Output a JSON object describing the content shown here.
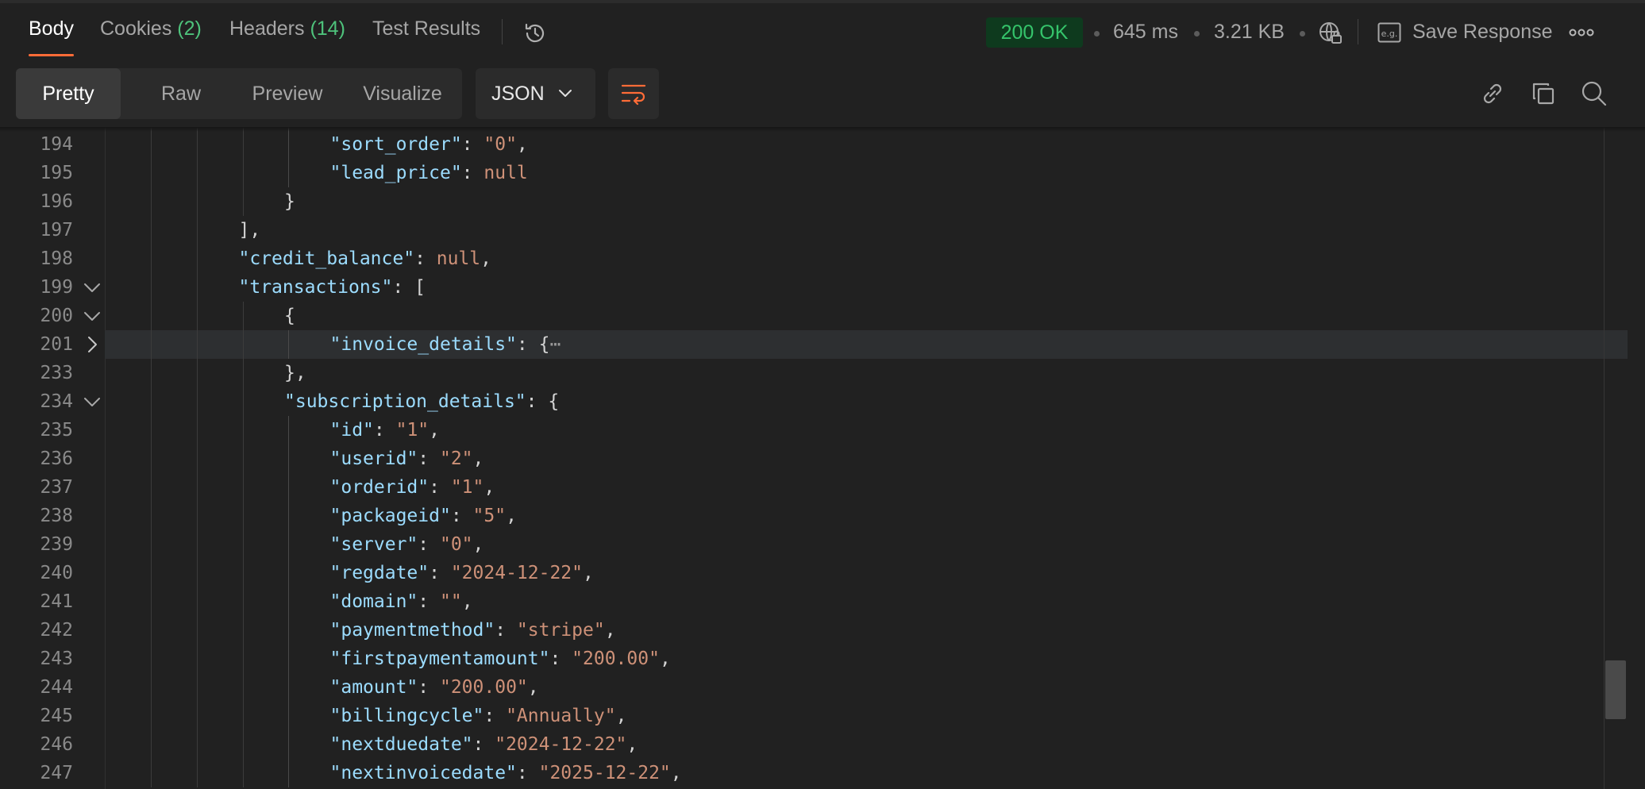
{
  "tabs": [
    {
      "label": "Body",
      "count": ""
    },
    {
      "label": "Cookies",
      "count": "(2)"
    },
    {
      "label": "Headers",
      "count": "(14)"
    },
    {
      "label": "Test Results",
      "count": ""
    }
  ],
  "status": {
    "code": "200 OK",
    "time": "645 ms",
    "size": "3.21 KB",
    "save_label": "Save Response"
  },
  "icons": {
    "history": "history-icon",
    "network": "globe-lock-icon",
    "example": "example-icon",
    "more": "more-icon",
    "wrap": "wrap-lines-icon",
    "link": "link-icon",
    "copy": "copy-icon",
    "search": "search-icon",
    "fold_open": "chevron-down-icon",
    "fold_closed": "chevron-right-icon"
  },
  "colors": {
    "accent": "#ff6c37",
    "status_ok": "#35c46b",
    "json_key": "#9cdcfe",
    "json_string": "#ce9178"
  },
  "toolbar": {
    "views": [
      "Pretty",
      "Raw",
      "Preview",
      "Visualize"
    ],
    "active_view": "Pretty",
    "format": "JSON"
  },
  "code": {
    "lines": [
      {
        "ln": "194",
        "parts": [
          {
            "c": "k",
            "t": "\"sort_order\""
          },
          {
            "c": "p",
            "t": ": "
          },
          {
            "c": "s",
            "t": "\"0\""
          },
          {
            "c": "p",
            "t": ","
          }
        ]
      },
      {
        "ln": "195",
        "parts": [
          {
            "c": "k",
            "t": "\"lead_price\""
          },
          {
            "c": "p",
            "t": ": "
          },
          {
            "c": "n",
            "t": "null"
          }
        ]
      },
      {
        "ln": "196",
        "parts": [
          {
            "c": "p",
            "t": "}"
          }
        ]
      },
      {
        "ln": "197",
        "parts": [
          {
            "c": "p",
            "t": "],"
          }
        ]
      },
      {
        "ln": "198",
        "parts": [
          {
            "c": "k",
            "t": "\"credit_balance\""
          },
          {
            "c": "p",
            "t": ": "
          },
          {
            "c": "n",
            "t": "null"
          },
          {
            "c": "p",
            "t": ","
          }
        ]
      },
      {
        "ln": "199",
        "parts": [
          {
            "c": "k",
            "t": "\"transactions\""
          },
          {
            "c": "p",
            "t": ": ["
          }
        ]
      },
      {
        "ln": "200",
        "parts": [
          {
            "c": "p",
            "t": "{"
          }
        ]
      },
      {
        "ln": "201",
        "parts": [
          {
            "c": "k",
            "t": "\"invoice_details\""
          },
          {
            "c": "p",
            "t": ": {"
          },
          {
            "c": "ell",
            "t": "⋯"
          }
        ]
      },
      {
        "ln": "233",
        "parts": [
          {
            "c": "p",
            "t": "},"
          }
        ]
      },
      {
        "ln": "234",
        "parts": [
          {
            "c": "k",
            "t": "\"subscription_details\""
          },
          {
            "c": "p",
            "t": ": {"
          }
        ]
      },
      {
        "ln": "235",
        "parts": [
          {
            "c": "k",
            "t": "\"id\""
          },
          {
            "c": "p",
            "t": ": "
          },
          {
            "c": "s",
            "t": "\"1\""
          },
          {
            "c": "p",
            "t": ","
          }
        ]
      },
      {
        "ln": "236",
        "parts": [
          {
            "c": "k",
            "t": "\"userid\""
          },
          {
            "c": "p",
            "t": ": "
          },
          {
            "c": "s",
            "t": "\"2\""
          },
          {
            "c": "p",
            "t": ","
          }
        ]
      },
      {
        "ln": "237",
        "parts": [
          {
            "c": "k",
            "t": "\"orderid\""
          },
          {
            "c": "p",
            "t": ": "
          },
          {
            "c": "s",
            "t": "\"1\""
          },
          {
            "c": "p",
            "t": ","
          }
        ]
      },
      {
        "ln": "238",
        "parts": [
          {
            "c": "k",
            "t": "\"packageid\""
          },
          {
            "c": "p",
            "t": ": "
          },
          {
            "c": "s",
            "t": "\"5\""
          },
          {
            "c": "p",
            "t": ","
          }
        ]
      },
      {
        "ln": "239",
        "parts": [
          {
            "c": "k",
            "t": "\"server\""
          },
          {
            "c": "p",
            "t": ": "
          },
          {
            "c": "s",
            "t": "\"0\""
          },
          {
            "c": "p",
            "t": ","
          }
        ]
      },
      {
        "ln": "240",
        "parts": [
          {
            "c": "k",
            "t": "\"regdate\""
          },
          {
            "c": "p",
            "t": ": "
          },
          {
            "c": "s",
            "t": "\"2024-12-22\""
          },
          {
            "c": "p",
            "t": ","
          }
        ]
      },
      {
        "ln": "241",
        "parts": [
          {
            "c": "k",
            "t": "\"domain\""
          },
          {
            "c": "p",
            "t": ": "
          },
          {
            "c": "s",
            "t": "\"\""
          },
          {
            "c": "p",
            "t": ","
          }
        ]
      },
      {
        "ln": "242",
        "parts": [
          {
            "c": "k",
            "t": "\"paymentmethod\""
          },
          {
            "c": "p",
            "t": ": "
          },
          {
            "c": "s",
            "t": "\"stripe\""
          },
          {
            "c": "p",
            "t": ","
          }
        ]
      },
      {
        "ln": "243",
        "parts": [
          {
            "c": "k",
            "t": "\"firstpaymentamount\""
          },
          {
            "c": "p",
            "t": ": "
          },
          {
            "c": "s",
            "t": "\"200.00\""
          },
          {
            "c": "p",
            "t": ","
          }
        ]
      },
      {
        "ln": "244",
        "parts": [
          {
            "c": "k",
            "t": "\"amount\""
          },
          {
            "c": "p",
            "t": ": "
          },
          {
            "c": "s",
            "t": "\"200.00\""
          },
          {
            "c": "p",
            "t": ","
          }
        ]
      },
      {
        "ln": "245",
        "parts": [
          {
            "c": "k",
            "t": "\"billingcycle\""
          },
          {
            "c": "p",
            "t": ": "
          },
          {
            "c": "s",
            "t": "\"Annually\""
          },
          {
            "c": "p",
            "t": ","
          }
        ]
      },
      {
        "ln": "246",
        "parts": [
          {
            "c": "k",
            "t": "\"nextduedate\""
          },
          {
            "c": "p",
            "t": ": "
          },
          {
            "c": "s",
            "t": "\"2024-12-22\""
          },
          {
            "c": "p",
            "t": ","
          }
        ]
      },
      {
        "ln": "247",
        "parts": [
          {
            "c": "k",
            "t": "\"nextinvoicedate\""
          },
          {
            "c": "p",
            "t": ": "
          },
          {
            "c": "s",
            "t": "\"2025-12-22\""
          },
          {
            "c": "p",
            "t": ","
          }
        ]
      }
    ]
  }
}
